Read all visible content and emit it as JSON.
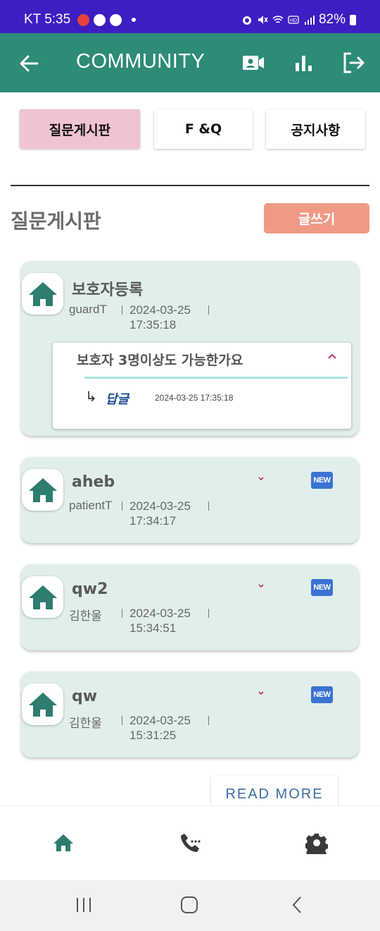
{
  "status": {
    "carrier_time": "KT 5:35",
    "battery": "82%"
  },
  "appbar": {
    "title": "COMMUNITY"
  },
  "tabs": [
    {
      "label": "질문게시판",
      "active": true
    },
    {
      "label": "F &Q",
      "active": false
    },
    {
      "label": "공지사항",
      "active": false
    }
  ],
  "section": {
    "title": "질문게시판",
    "write_label": "글쓰기"
  },
  "posts": [
    {
      "title": "보호자등록",
      "author": "guardT",
      "date": "2024-03-25",
      "time": "17:35:18",
      "expanded": true,
      "question": "보호자 3명이상도 가능한가요",
      "reply_label": "답글",
      "reply_date": "2024-03-25 17:35:18"
    },
    {
      "title": "aheb",
      "author": "patientT",
      "date": "2024-03-25",
      "time": "17:34:17",
      "new": true,
      "new_label": "NEW"
    },
    {
      "title": "qw2",
      "author": "김한울",
      "date": "2024-03-25",
      "time": "15:34:51",
      "new": true,
      "new_label": "NEW"
    },
    {
      "title": "qw",
      "author": "김한울",
      "date": "2024-03-25",
      "time": "15:31:25",
      "new": true,
      "new_label": "NEW"
    }
  ],
  "read_more": "READ MORE",
  "icons": {
    "back": "arrow-left-icon",
    "video": "video-contact-icon",
    "chart": "bar-chart-icon",
    "logout": "logout-icon",
    "home": "home-icon",
    "phone": "phone-icon",
    "settings": "gear-icon"
  },
  "colors": {
    "appbar": "#2d8b78",
    "statusbar": "#3d1ec2",
    "card": "#e0efec",
    "active_tab": "#f0c3d1",
    "write_button": "#f09a86"
  }
}
